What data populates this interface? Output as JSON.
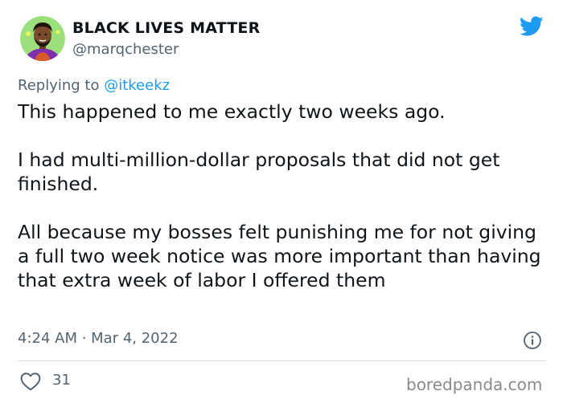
{
  "author": {
    "display_name": "BLACK LIVES MATTER",
    "handle": "@marqchester",
    "avatar": "cartoon-avatar"
  },
  "brand_icon": "twitter-bird-icon",
  "reply": {
    "prefix": "Replying to",
    "mention": "@itkeekz"
  },
  "tweet": {
    "paragraphs": [
      "This happened to me exactly two weeks ago.",
      "I had multi-million-dollar proposals that did not get finished.",
      "All because my bosses felt punishing me for not giving a full two week notice was more important than having that extra week of labor I offered them"
    ],
    "timestamp": "4:24 AM · Mar 4, 2022"
  },
  "engagement": {
    "likes": "31"
  },
  "watermark": "boredpanda.com",
  "colors": {
    "twitter_blue": "#1d9bf0",
    "text_primary": "#0f1419",
    "text_secondary": "#536471",
    "avatar_bg": "#9be07a"
  }
}
